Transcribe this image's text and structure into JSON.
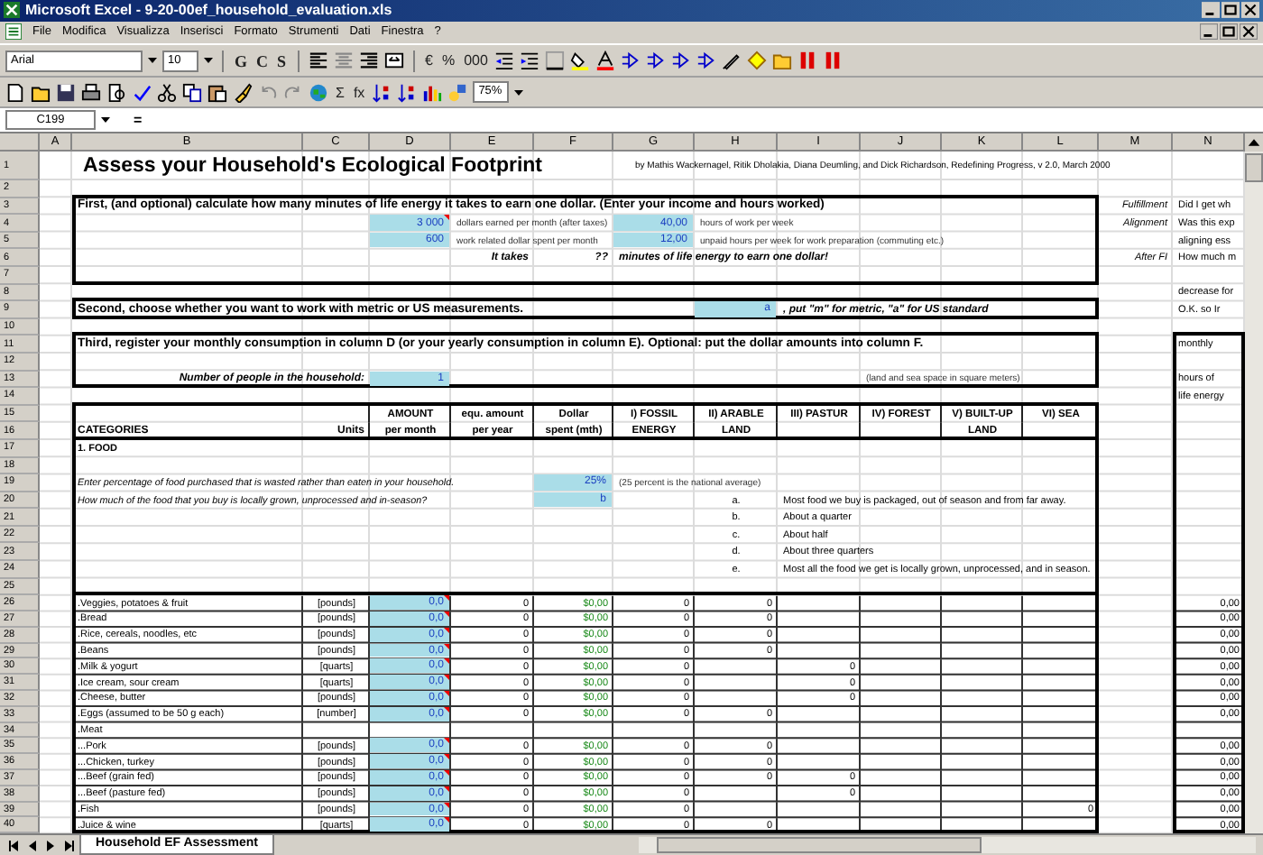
{
  "window": {
    "title": "Microsoft Excel - 9-20-00ef_household_evaluation.xls"
  },
  "menu": [
    "File",
    "Modifica",
    "Visualizza",
    "Inserisci",
    "Formato",
    "Strumenti",
    "Dati",
    "Finestra",
    "?"
  ],
  "format_toolbar": {
    "font": "Arial",
    "size": "10",
    "styles": [
      "G",
      "C",
      "S"
    ],
    "symbols": [
      "€",
      "%",
      "000"
    ]
  },
  "standard_toolbar": {
    "symbols": [
      "Σ",
      "fx"
    ],
    "zoom": "75%"
  },
  "formula_bar": {
    "name_box": "C199",
    "formula": "="
  },
  "sheet": {
    "columns": [
      "A",
      "B",
      "C",
      "D",
      "E",
      "F",
      "G",
      "H",
      "I",
      "J",
      "K",
      "L",
      "M",
      "N"
    ],
    "rows": [
      {
        "number": "1",
        "kind": "plain",
        "cells": {
          "B": {
            "kind": "title",
            "text": "Assess your Household's Ecological Footprint"
          },
          "G": {
            "kind": "byline",
            "text": "by Mathis Wackernagel, Ritik Dholakia, Diana Deumling, and Dick Richardson, Redefining Progress, v 2.0, March 2000"
          }
        }
      },
      {
        "number": "2",
        "kind": "plain"
      },
      {
        "number": "3",
        "kind": "plain",
        "cells": {
          "B": {
            "kind": "section",
            "text": "First, (and optional) calculate how many minutes of life energy it takes to earn one dollar. (Enter your income and hours worked)"
          },
          "M": {
            "kind": "aspect",
            "text": "Fulfillment"
          },
          "N": {
            "kind": "side",
            "text": "Did I get wh"
          }
        }
      },
      {
        "number": "4",
        "kind": "plain",
        "cells": {
          "D": {
            "kind": "input",
            "text": "3 000",
            "comment": true
          },
          "E": {
            "kind": "note",
            "text": "dollars earned per month (after taxes)"
          },
          "G": {
            "kind": "input",
            "text": "40,00"
          },
          "H": {
            "kind": "note",
            "text": "hours of work per week"
          },
          "M": {
            "kind": "aspect",
            "text": "Alignment"
          },
          "N": {
            "kind": "side",
            "text": "Was this exp"
          }
        }
      },
      {
        "number": "5",
        "kind": "plain",
        "cells": {
          "D": {
            "kind": "input",
            "text": "600"
          },
          "E": {
            "kind": "note",
            "text": "work related dollar spent per month"
          },
          "G": {
            "kind": "input",
            "text": "12,00"
          },
          "H": {
            "kind": "note",
            "text": "unpaid hours per week for work preparation (commuting etc.)"
          },
          "N": {
            "kind": "side",
            "text": "aligning ess"
          }
        }
      },
      {
        "number": "6",
        "kind": "plain",
        "cells": {
          "E": {
            "kind": "prompt",
            "text": "It takes"
          },
          "F": {
            "kind": "prompt",
            "text": "??"
          },
          "G": {
            "kind": "statement",
            "text": "minutes of life energy to earn one dollar!"
          },
          "M": {
            "kind": "aspect",
            "text": "After FI"
          },
          "N": {
            "kind": "side",
            "text": "How much m"
          }
        }
      },
      {
        "number": "7",
        "kind": "plain"
      },
      {
        "number": "8",
        "kind": "plain",
        "cells": {
          "N": {
            "kind": "side",
            "text": "decrease for"
          }
        }
      },
      {
        "number": "9",
        "kind": "plain",
        "cells": {
          "B": {
            "kind": "section",
            "text": "Second, choose whether you want to work with metric or US measurements."
          },
          "H": {
            "kind": "input",
            "text": "a"
          },
          "I": {
            "kind": "statement",
            "text": ", put \"m\" for metric, \"a\" for US standard"
          },
          "N": {
            "kind": "side",
            "text": "O.K. so Ir"
          }
        }
      },
      {
        "number": "10",
        "kind": "plain"
      },
      {
        "number": "11",
        "kind": "plain",
        "cells": {
          "B": {
            "kind": "section",
            "text": "Third, register your monthly consumption in column D (or your yearly consumption in column E). Optional: put the dollar amounts into column F."
          },
          "N": {
            "kind": "side",
            "text": "monthly"
          }
        }
      },
      {
        "number": "12",
        "kind": "plain"
      },
      {
        "number": "13",
        "kind": "plain",
        "cells": {
          "B": {
            "kind": "prompt",
            "text": "Number of people in the household:"
          },
          "D": {
            "kind": "input",
            "text": "1"
          },
          "J": {
            "kind": "note",
            "text": "(land and sea space in square meters)"
          },
          "N": {
            "kind": "side",
            "text": "hours of"
          }
        }
      },
      {
        "number": "14",
        "kind": "plain",
        "cells": {
          "N": {
            "kind": "side",
            "text": "life energy"
          }
        }
      },
      {
        "number": "15",
        "kind": "header",
        "cells": {
          "D": {
            "kind": "header",
            "text": "AMOUNT"
          },
          "E": {
            "kind": "header",
            "text": "equ. amount"
          },
          "F": {
            "kind": "header",
            "text": "Dollar"
          },
          "G": {
            "kind": "header",
            "text": "I) FOSSIL"
          },
          "H": {
            "kind": "header",
            "text": "II) ARABLE"
          },
          "I": {
            "kind": "header",
            "text": "III) PASTUR"
          },
          "J": {
            "kind": "header",
            "text": "IV) FOREST"
          },
          "K": {
            "kind": "header",
            "text": "V) BUILT-UP"
          },
          "L": {
            "kind": "header",
            "text": "VI) SEA"
          }
        }
      },
      {
        "number": "16",
        "kind": "header",
        "cells": {
          "B": {
            "kind": "label",
            "text": "CATEGORIES"
          },
          "C": {
            "kind": "caption",
            "text": "Units"
          },
          "D": {
            "kind": "header",
            "text": "per month"
          },
          "E": {
            "kind": "header",
            "text": "per year"
          },
          "F": {
            "kind": "header",
            "text": "spent (mth)"
          },
          "G": {
            "kind": "header",
            "text": "ENERGY"
          },
          "H": {
            "kind": "header",
            "text": "LAND"
          },
          "K": {
            "kind": "header",
            "text": "LAND"
          }
        }
      },
      {
        "number": "17",
        "kind": "plain",
        "cells": {
          "B": {
            "kind": "category",
            "text": "1. FOOD"
          }
        }
      },
      {
        "number": "18",
        "kind": "plain"
      },
      {
        "number": "19",
        "kind": "plain",
        "cells": {
          "B": {
            "kind": "question",
            "text": "Enter percentage of food purchased that is wasted rather than eaten in your household."
          },
          "F": {
            "kind": "input",
            "text": "25%"
          },
          "G": {
            "kind": "note",
            "text": "(25 percent is the national average)"
          }
        }
      },
      {
        "number": "20",
        "kind": "plain",
        "cells": {
          "B": {
            "kind": "question",
            "text": "How much of the food that you buy is locally grown, unprocessed and in-season?"
          },
          "F": {
            "kind": "input",
            "text": "b"
          },
          "H": {
            "kind": "letter",
            "text": "a."
          },
          "I": {
            "kind": "option",
            "text": "Most food we buy is packaged, out of season and from far away."
          }
        }
      },
      {
        "number": "21",
        "kind": "plain",
        "cells": {
          "H": {
            "kind": "letter",
            "text": "b."
          },
          "I": {
            "kind": "option",
            "text": "About a quarter"
          }
        }
      },
      {
        "number": "22",
        "kind": "plain",
        "cells": {
          "H": {
            "kind": "letter",
            "text": "c."
          },
          "I": {
            "kind": "option",
            "text": "About half"
          }
        }
      },
      {
        "number": "23",
        "kind": "plain",
        "cells": {
          "H": {
            "kind": "letter",
            "text": "d."
          },
          "I": {
            "kind": "option",
            "text": "About three quarters"
          }
        }
      },
      {
        "number": "24",
        "kind": "plain",
        "cells": {
          "H": {
            "kind": "letter",
            "text": "e."
          },
          "I": {
            "kind": "option",
            "text": "Most all the food we get is locally grown, unprocessed, and in season."
          }
        }
      },
      {
        "number": "25",
        "kind": "plain"
      },
      {
        "number": "26",
        "kind": "table",
        "cells": {
          "B": {
            "kind": "item",
            "text": ".Veggies, potatoes & fruit"
          },
          "C": {
            "kind": "unit",
            "text": "[pounds]"
          },
          "D": {
            "kind": "input",
            "text": "0,0",
            "comment": true
          },
          "E": {
            "kind": "number",
            "text": "0"
          },
          "F": {
            "kind": "money",
            "text": "$0,00"
          },
          "G": {
            "kind": "number",
            "text": "0"
          },
          "H": {
            "kind": "number",
            "text": "0"
          },
          "N": {
            "kind": "number",
            "text": "0,00"
          }
        }
      },
      {
        "number": "27",
        "kind": "table",
        "cells": {
          "B": {
            "kind": "item",
            "text": ".Bread"
          },
          "C": {
            "kind": "unit",
            "text": "[pounds]"
          },
          "D": {
            "kind": "input",
            "text": "0,0",
            "comment": true
          },
          "E": {
            "kind": "number",
            "text": "0"
          },
          "F": {
            "kind": "money",
            "text": "$0,00"
          },
          "G": {
            "kind": "number",
            "text": "0"
          },
          "H": {
            "kind": "number",
            "text": "0"
          },
          "N": {
            "kind": "number",
            "text": "0,00"
          }
        }
      },
      {
        "number": "28",
        "kind": "table",
        "cells": {
          "B": {
            "kind": "item",
            "text": ".Rice, cereals, noodles, etc"
          },
          "C": {
            "kind": "unit",
            "text": "[pounds]"
          },
          "D": {
            "kind": "input",
            "text": "0,0",
            "comment": true
          },
          "E": {
            "kind": "number",
            "text": "0"
          },
          "F": {
            "kind": "money",
            "text": "$0,00"
          },
          "G": {
            "kind": "number",
            "text": "0"
          },
          "H": {
            "kind": "number",
            "text": "0"
          },
          "N": {
            "kind": "number",
            "text": "0,00"
          }
        }
      },
      {
        "number": "29",
        "kind": "table",
        "cells": {
          "B": {
            "kind": "item",
            "text": ".Beans"
          },
          "C": {
            "kind": "unit",
            "text": "[pounds]"
          },
          "D": {
            "kind": "input",
            "text": "0,0",
            "comment": true
          },
          "E": {
            "kind": "number",
            "text": "0"
          },
          "F": {
            "kind": "money",
            "text": "$0,00"
          },
          "G": {
            "kind": "number",
            "text": "0"
          },
          "H": {
            "kind": "number",
            "text": "0"
          },
          "N": {
            "kind": "number",
            "text": "0,00"
          }
        }
      },
      {
        "number": "30",
        "kind": "table",
        "cells": {
          "B": {
            "kind": "item",
            "text": ".Milk & yogurt"
          },
          "C": {
            "kind": "unit",
            "text": "[quarts]"
          },
          "D": {
            "kind": "input",
            "text": "0,0",
            "comment": true
          },
          "E": {
            "kind": "number",
            "text": "0"
          },
          "F": {
            "kind": "money",
            "text": "$0,00"
          },
          "G": {
            "kind": "number",
            "text": "0"
          },
          "I": {
            "kind": "number",
            "text": "0"
          },
          "N": {
            "kind": "number",
            "text": "0,00"
          }
        }
      },
      {
        "number": "31",
        "kind": "table",
        "cells": {
          "B": {
            "kind": "item",
            "text": ".Ice cream, sour cream"
          },
          "C": {
            "kind": "unit",
            "text": "[quarts]"
          },
          "D": {
            "kind": "input",
            "text": "0,0",
            "comment": true
          },
          "E": {
            "kind": "number",
            "text": "0"
          },
          "F": {
            "kind": "money",
            "text": "$0,00"
          },
          "G": {
            "kind": "number",
            "text": "0"
          },
          "I": {
            "kind": "number",
            "text": "0"
          },
          "N": {
            "kind": "number",
            "text": "0,00"
          }
        }
      },
      {
        "number": "32",
        "kind": "table",
        "cells": {
          "B": {
            "kind": "item",
            "text": ".Cheese, butter"
          },
          "C": {
            "kind": "unit",
            "text": "[pounds]"
          },
          "D": {
            "kind": "input",
            "text": "0,0",
            "comment": true
          },
          "E": {
            "kind": "number",
            "text": "0"
          },
          "F": {
            "kind": "money",
            "text": "$0,00"
          },
          "G": {
            "kind": "number",
            "text": "0"
          },
          "I": {
            "kind": "number",
            "text": "0"
          },
          "N": {
            "kind": "number",
            "text": "0,00"
          }
        }
      },
      {
        "number": "33",
        "kind": "table",
        "cells": {
          "B": {
            "kind": "item",
            "text": ".Eggs (assumed to be 50 g each)"
          },
          "C": {
            "kind": "unit",
            "text": "[number]"
          },
          "D": {
            "kind": "input",
            "text": "0,0",
            "comment": true
          },
          "E": {
            "kind": "number",
            "text": "0"
          },
          "F": {
            "kind": "money",
            "text": "$0,00"
          },
          "G": {
            "kind": "number",
            "text": "0"
          },
          "H": {
            "kind": "number",
            "text": "0"
          },
          "N": {
            "kind": "number",
            "text": "0,00"
          }
        }
      },
      {
        "number": "34",
        "kind": "table",
        "cells": {
          "B": {
            "kind": "item",
            "text": ".Meat"
          }
        }
      },
      {
        "number": "35",
        "kind": "table",
        "cells": {
          "B": {
            "kind": "item",
            "text": "...Pork"
          },
          "C": {
            "kind": "unit",
            "text": "[pounds]"
          },
          "D": {
            "kind": "input",
            "text": "0,0",
            "comment": true
          },
          "E": {
            "kind": "number",
            "text": "0"
          },
          "F": {
            "kind": "money",
            "text": "$0,00"
          },
          "G": {
            "kind": "number",
            "text": "0"
          },
          "H": {
            "kind": "number",
            "text": "0"
          },
          "N": {
            "kind": "number",
            "text": "0,00"
          }
        }
      },
      {
        "number": "36",
        "kind": "table",
        "cells": {
          "B": {
            "kind": "item",
            "text": "...Chicken, turkey"
          },
          "C": {
            "kind": "unit",
            "text": "[pounds]"
          },
          "D": {
            "kind": "input",
            "text": "0,0",
            "comment": true
          },
          "E": {
            "kind": "number",
            "text": "0"
          },
          "F": {
            "kind": "money",
            "text": "$0,00"
          },
          "G": {
            "kind": "number",
            "text": "0"
          },
          "H": {
            "kind": "number",
            "text": "0"
          },
          "N": {
            "kind": "number",
            "text": "0,00"
          }
        }
      },
      {
        "number": "37",
        "kind": "table",
        "cells": {
          "B": {
            "kind": "item",
            "text": "...Beef (grain fed)"
          },
          "C": {
            "kind": "unit",
            "text": "[pounds]"
          },
          "D": {
            "kind": "input",
            "text": "0,0",
            "comment": true
          },
          "E": {
            "kind": "number",
            "text": "0"
          },
          "F": {
            "kind": "money",
            "text": "$0,00"
          },
          "G": {
            "kind": "number",
            "text": "0"
          },
          "H": {
            "kind": "number",
            "text": "0"
          },
          "I": {
            "kind": "number",
            "text": "0"
          },
          "N": {
            "kind": "number",
            "text": "0,00"
          }
        }
      },
      {
        "number": "38",
        "kind": "table",
        "cells": {
          "B": {
            "kind": "item",
            "text": "...Beef (pasture fed)"
          },
          "C": {
            "kind": "unit",
            "text": "[pounds]"
          },
          "D": {
            "kind": "input",
            "text": "0,0",
            "comment": true
          },
          "E": {
            "kind": "number",
            "text": "0"
          },
          "F": {
            "kind": "money",
            "text": "$0,00"
          },
          "G": {
            "kind": "number",
            "text": "0"
          },
          "I": {
            "kind": "number",
            "text": "0"
          },
          "N": {
            "kind": "number",
            "text": "0,00"
          }
        }
      },
      {
        "number": "39",
        "kind": "table",
        "cells": {
          "B": {
            "kind": "item",
            "text": ".Fish"
          },
          "C": {
            "kind": "unit",
            "text": "[pounds]"
          },
          "D": {
            "kind": "input",
            "text": "0,0",
            "comment": true
          },
          "E": {
            "kind": "number",
            "text": "0"
          },
          "F": {
            "kind": "money",
            "text": "$0,00"
          },
          "G": {
            "kind": "number",
            "text": "0"
          },
          "L": {
            "kind": "number",
            "text": "0"
          },
          "N": {
            "kind": "number",
            "text": "0,00"
          }
        }
      },
      {
        "number": "40",
        "kind": "table",
        "cells": {
          "B": {
            "kind": "item",
            "text": ".Juice & wine"
          },
          "C": {
            "kind": "unit",
            "text": "[quarts]"
          },
          "D": {
            "kind": "input",
            "text": "0,0",
            "comment": true
          },
          "E": {
            "kind": "number",
            "text": "0"
          },
          "F": {
            "kind": "money",
            "text": "$0,00"
          },
          "G": {
            "kind": "number",
            "text": "0"
          },
          "H": {
            "kind": "number",
            "text": "0"
          },
          "N": {
            "kind": "number",
            "text": "0,00"
          }
        }
      }
    ]
  },
  "sheet_tabs": [
    {
      "label": "Household EF Assessment",
      "selected": true
    }
  ]
}
